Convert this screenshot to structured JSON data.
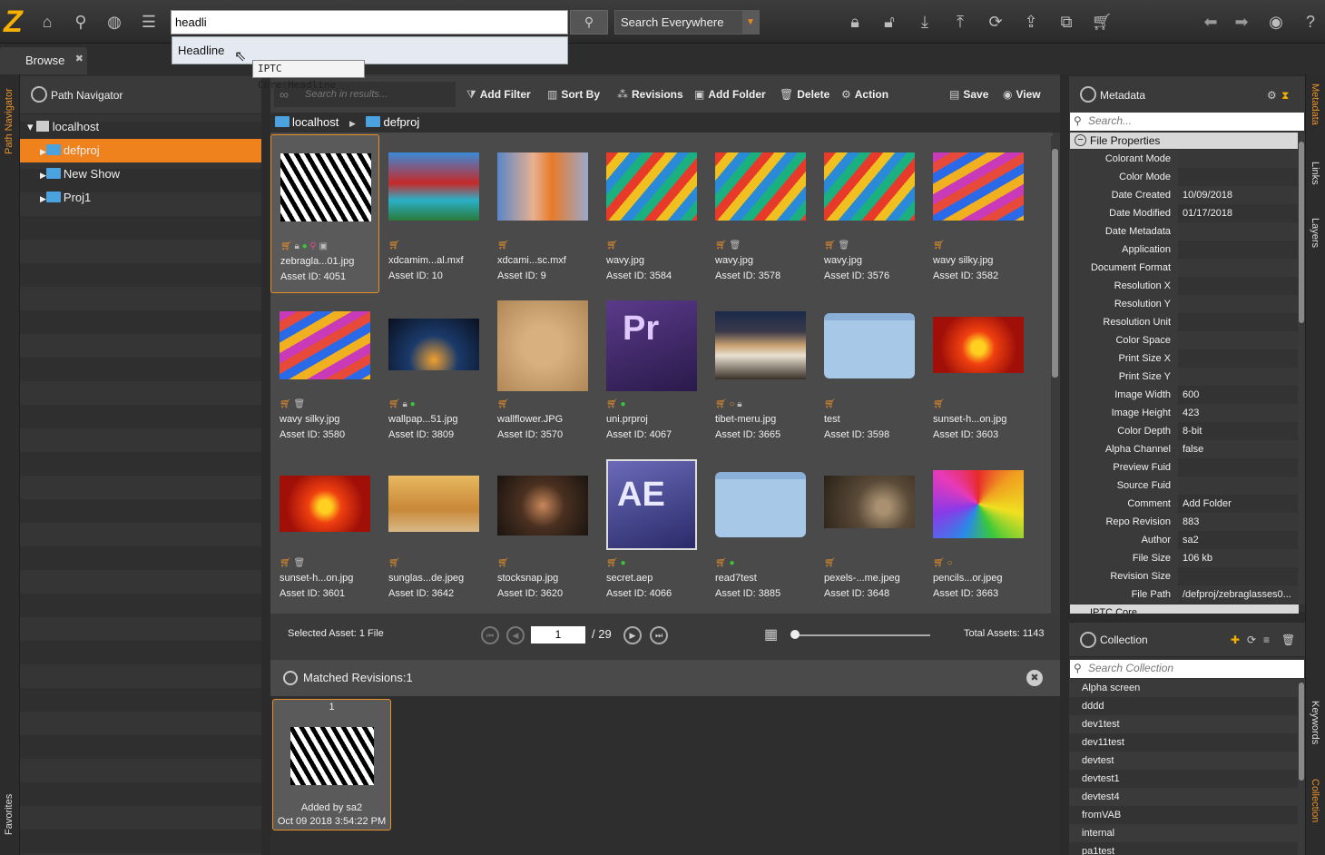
{
  "search": {
    "value": "headli",
    "scope": "Search Everywhere",
    "suggestion": "Headline",
    "tooltip": "IPTC Core:Headline"
  },
  "tabs": {
    "browse": "Browse"
  },
  "rail": {
    "path_navigator": "Path Navigator",
    "favorites": "Favorites",
    "metadata": "Metadata",
    "links": "Links",
    "layers": "Layers",
    "keywords": "Keywords",
    "collection": "Collection"
  },
  "nav": {
    "title": "Path Navigator",
    "items": [
      {
        "label": "localhost"
      },
      {
        "label": "defproj"
      },
      {
        "label": "New Show"
      },
      {
        "label": "Proj1"
      }
    ]
  },
  "toolbar": {
    "search_placeholder": "Search in results...",
    "add_filter": "Add Filter",
    "sort_by": "Sort By",
    "revisions": "Revisions",
    "add_folder": "Add Folder",
    "delete": "Delete",
    "action": "Action",
    "save": "Save",
    "view": "View"
  },
  "breadcrumb": {
    "root": "localhost",
    "current": "defproj"
  },
  "assets": [
    {
      "name": "zebragla...01.jpg",
      "id": "Asset ID: 4051"
    },
    {
      "name": "xdcamim...al.mxf",
      "id": "Asset ID: 10"
    },
    {
      "name": "xdcami...sc.mxf",
      "id": "Asset ID: 9"
    },
    {
      "name": "wavy.jpg",
      "id": "Asset ID: 3584"
    },
    {
      "name": "wavy.jpg",
      "id": "Asset ID: 3578"
    },
    {
      "name": "wavy.jpg",
      "id": "Asset ID: 3576"
    },
    {
      "name": "wavy silky.jpg",
      "id": "Asset ID: 3582"
    },
    {
      "name": "wavy silky.jpg",
      "id": "Asset ID: 3580"
    },
    {
      "name": "wallpap...51.jpg",
      "id": "Asset ID: 3809"
    },
    {
      "name": "wallflower.JPG",
      "id": "Asset ID: 3570"
    },
    {
      "name": "uni.prproj",
      "id": "Asset ID: 4067"
    },
    {
      "name": "tibet-meru.jpg",
      "id": "Asset ID: 3665"
    },
    {
      "name": "test",
      "id": "Asset ID: 3598"
    },
    {
      "name": "sunset-h...on.jpg",
      "id": "Asset ID: 3603"
    },
    {
      "name": "sunset-h...on.jpg",
      "id": "Asset ID: 3601"
    },
    {
      "name": "sunglas...de.jpeg",
      "id": "Asset ID: 3642"
    },
    {
      "name": "stocksnap.jpg",
      "id": "Asset ID: 3620"
    },
    {
      "name": "secret.aep",
      "id": "Asset ID: 4066"
    },
    {
      "name": "read7test",
      "id": "Asset ID: 3885"
    },
    {
      "name": "pexels-...me.jpeg",
      "id": "Asset ID: 3648"
    },
    {
      "name": "pencils...or.jpeg",
      "id": "Asset ID: 3663"
    }
  ],
  "thumb_text": {
    "pr": "Pr",
    "ae": "AE"
  },
  "pager": {
    "selected": "Selected Asset: 1 File",
    "page": "1",
    "of": "/ 29",
    "total": "Total Assets: 1143"
  },
  "revisions": {
    "title": "Matched Revisions:1",
    "card_num": "1",
    "added_by": "Added by sa2",
    "date": "Oct 09 2018 3:54:22 PM"
  },
  "metadata": {
    "title": "Metadata",
    "search_placeholder": "Search...",
    "section": "File Properties",
    "next_section": "IPTC Core",
    "rows": [
      {
        "k": "Colorant Mode",
        "v": ""
      },
      {
        "k": "Color Mode",
        "v": ""
      },
      {
        "k": "Date Created",
        "v": "10/09/2018"
      },
      {
        "k": "Date Modified",
        "v": "01/17/2018"
      },
      {
        "k": "Date Metadata",
        "v": ""
      },
      {
        "k": "Application",
        "v": ""
      },
      {
        "k": "Document Format",
        "v": ""
      },
      {
        "k": "Resolution X",
        "v": ""
      },
      {
        "k": "Resolution Y",
        "v": ""
      },
      {
        "k": "Resolution Unit",
        "v": ""
      },
      {
        "k": "Color Space",
        "v": ""
      },
      {
        "k": "Print Size X",
        "v": ""
      },
      {
        "k": "Print Size Y",
        "v": ""
      },
      {
        "k": "Image Width",
        "v": "600"
      },
      {
        "k": "Image Height",
        "v": "423"
      },
      {
        "k": "Color Depth",
        "v": "8-bit"
      },
      {
        "k": "Alpha Channel",
        "v": "false"
      },
      {
        "k": "Preview Fuid",
        "v": ""
      },
      {
        "k": "Source Fuid",
        "v": ""
      },
      {
        "k": "Comment",
        "v": "Add Folder"
      },
      {
        "k": "Repo Revision",
        "v": "883"
      },
      {
        "k": "Author",
        "v": "sa2"
      },
      {
        "k": "File Size",
        "v": "106 kb"
      },
      {
        "k": "Revision Size",
        "v": ""
      },
      {
        "k": "File Path",
        "v": "/defproj/zebraglasses0..."
      }
    ]
  },
  "collection": {
    "title": "Collection",
    "search_placeholder": "Search Collection",
    "items": [
      "Alpha screen",
      "dddd",
      "dev1test",
      "dev11test",
      "devtest",
      "devtest1",
      "devtest4",
      "fromVAB",
      "internal",
      "pa1test"
    ]
  }
}
